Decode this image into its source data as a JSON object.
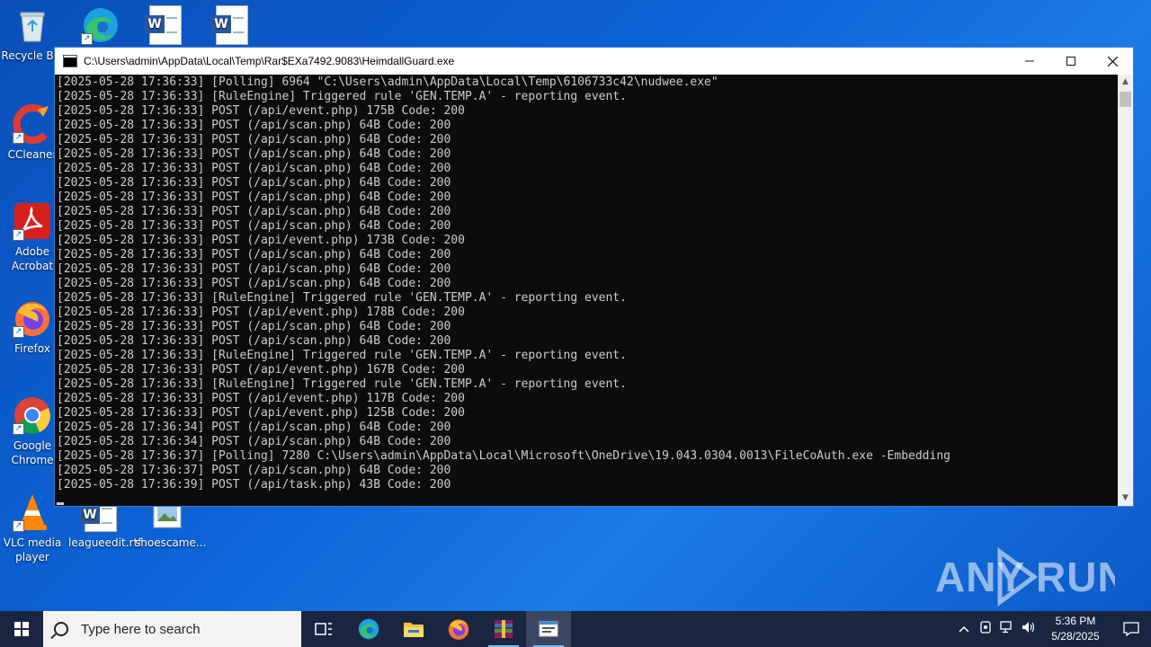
{
  "desktop": {
    "icons": [
      {
        "label": "Recycle Bin",
        "icon": "recycle-bin-icon"
      },
      {
        "label": "",
        "icon": "edge-icon"
      },
      {
        "label": "",
        "icon": "word-doc-icon"
      },
      {
        "label": "",
        "icon": "word-doc-icon"
      },
      {
        "label": "CCleaner",
        "icon": "ccleaner-icon"
      },
      {
        "label": "Adobe Acrobat",
        "icon": "acrobat-icon"
      },
      {
        "label": "Firefox",
        "icon": "firefox-icon"
      },
      {
        "label": "Google Chrome",
        "icon": "chrome-icon"
      },
      {
        "label": "VLC media player",
        "icon": "vlc-icon"
      },
      {
        "label": "leagueedit.rtf",
        "icon": "word-doc-icon"
      },
      {
        "label": "shoescame...",
        "icon": "image-file-icon"
      }
    ]
  },
  "window": {
    "title": "C:\\Users\\admin\\AppData\\Local\\Temp\\Rar$EXa7492.9083\\HeimdallGuard.exe",
    "console_lines": [
      "[2025-05-28 17:36:33] [Polling] 6964 \"C:\\Users\\admin\\AppData\\Local\\Temp\\6106733c42\\nudwee.exe\"",
      "[2025-05-28 17:36:33] [RuleEngine] Triggered rule 'GEN.TEMP.A' - reporting event.",
      "[2025-05-28 17:36:33] POST (/api/event.php) 175B Code: 200",
      "[2025-05-28 17:36:33] POST (/api/scan.php) 64B Code: 200",
      "[2025-05-28 17:36:33] POST (/api/scan.php) 64B Code: 200",
      "[2025-05-28 17:36:33] POST (/api/scan.php) 64B Code: 200",
      "[2025-05-28 17:36:33] POST (/api/scan.php) 64B Code: 200",
      "[2025-05-28 17:36:33] POST (/api/scan.php) 64B Code: 200",
      "[2025-05-28 17:36:33] POST (/api/scan.php) 64B Code: 200",
      "[2025-05-28 17:36:33] POST (/api/scan.php) 64B Code: 200",
      "[2025-05-28 17:36:33] POST (/api/scan.php) 64B Code: 200",
      "[2025-05-28 17:36:33] POST (/api/event.php) 173B Code: 200",
      "[2025-05-28 17:36:33] POST (/api/scan.php) 64B Code: 200",
      "[2025-05-28 17:36:33] POST (/api/scan.php) 64B Code: 200",
      "[2025-05-28 17:36:33] POST (/api/scan.php) 64B Code: 200",
      "[2025-05-28 17:36:33] [RuleEngine] Triggered rule 'GEN.TEMP.A' - reporting event.",
      "[2025-05-28 17:36:33] POST (/api/event.php) 178B Code: 200",
      "[2025-05-28 17:36:33] POST (/api/scan.php) 64B Code: 200",
      "[2025-05-28 17:36:33] POST (/api/scan.php) 64B Code: 200",
      "[2025-05-28 17:36:33] [RuleEngine] Triggered rule 'GEN.TEMP.A' - reporting event.",
      "[2025-05-28 17:36:33] POST (/api/event.php) 167B Code: 200",
      "[2025-05-28 17:36:33] [RuleEngine] Triggered rule 'GEN.TEMP.A' - reporting event.",
      "[2025-05-28 17:36:33] POST (/api/event.php) 117B Code: 200",
      "[2025-05-28 17:36:33] POST (/api/event.php) 125B Code: 200",
      "[2025-05-28 17:36:34] POST (/api/scan.php) 64B Code: 200",
      "[2025-05-28 17:36:34] POST (/api/scan.php) 64B Code: 200",
      "[2025-05-28 17:36:37] [Polling] 7280 C:\\Users\\admin\\AppData\\Local\\Microsoft\\OneDrive\\19.043.0304.0013\\FileCoAuth.exe -Embedding",
      "[2025-05-28 17:36:37] POST (/api/scan.php) 64B Code: 200",
      "[2025-05-28 17:36:39] POST (/api/task.php) 43B Code: 200"
    ]
  },
  "watermark": "ANY RUN",
  "taskbar": {
    "search_placeholder": "Type here to search",
    "apps": [
      "task-view-icon",
      "edge-icon",
      "file-explorer-icon",
      "firefox-icon",
      "winrar-icon",
      "console-icon"
    ],
    "clock_time": "5:36 PM",
    "clock_date": "5/28/2025"
  }
}
